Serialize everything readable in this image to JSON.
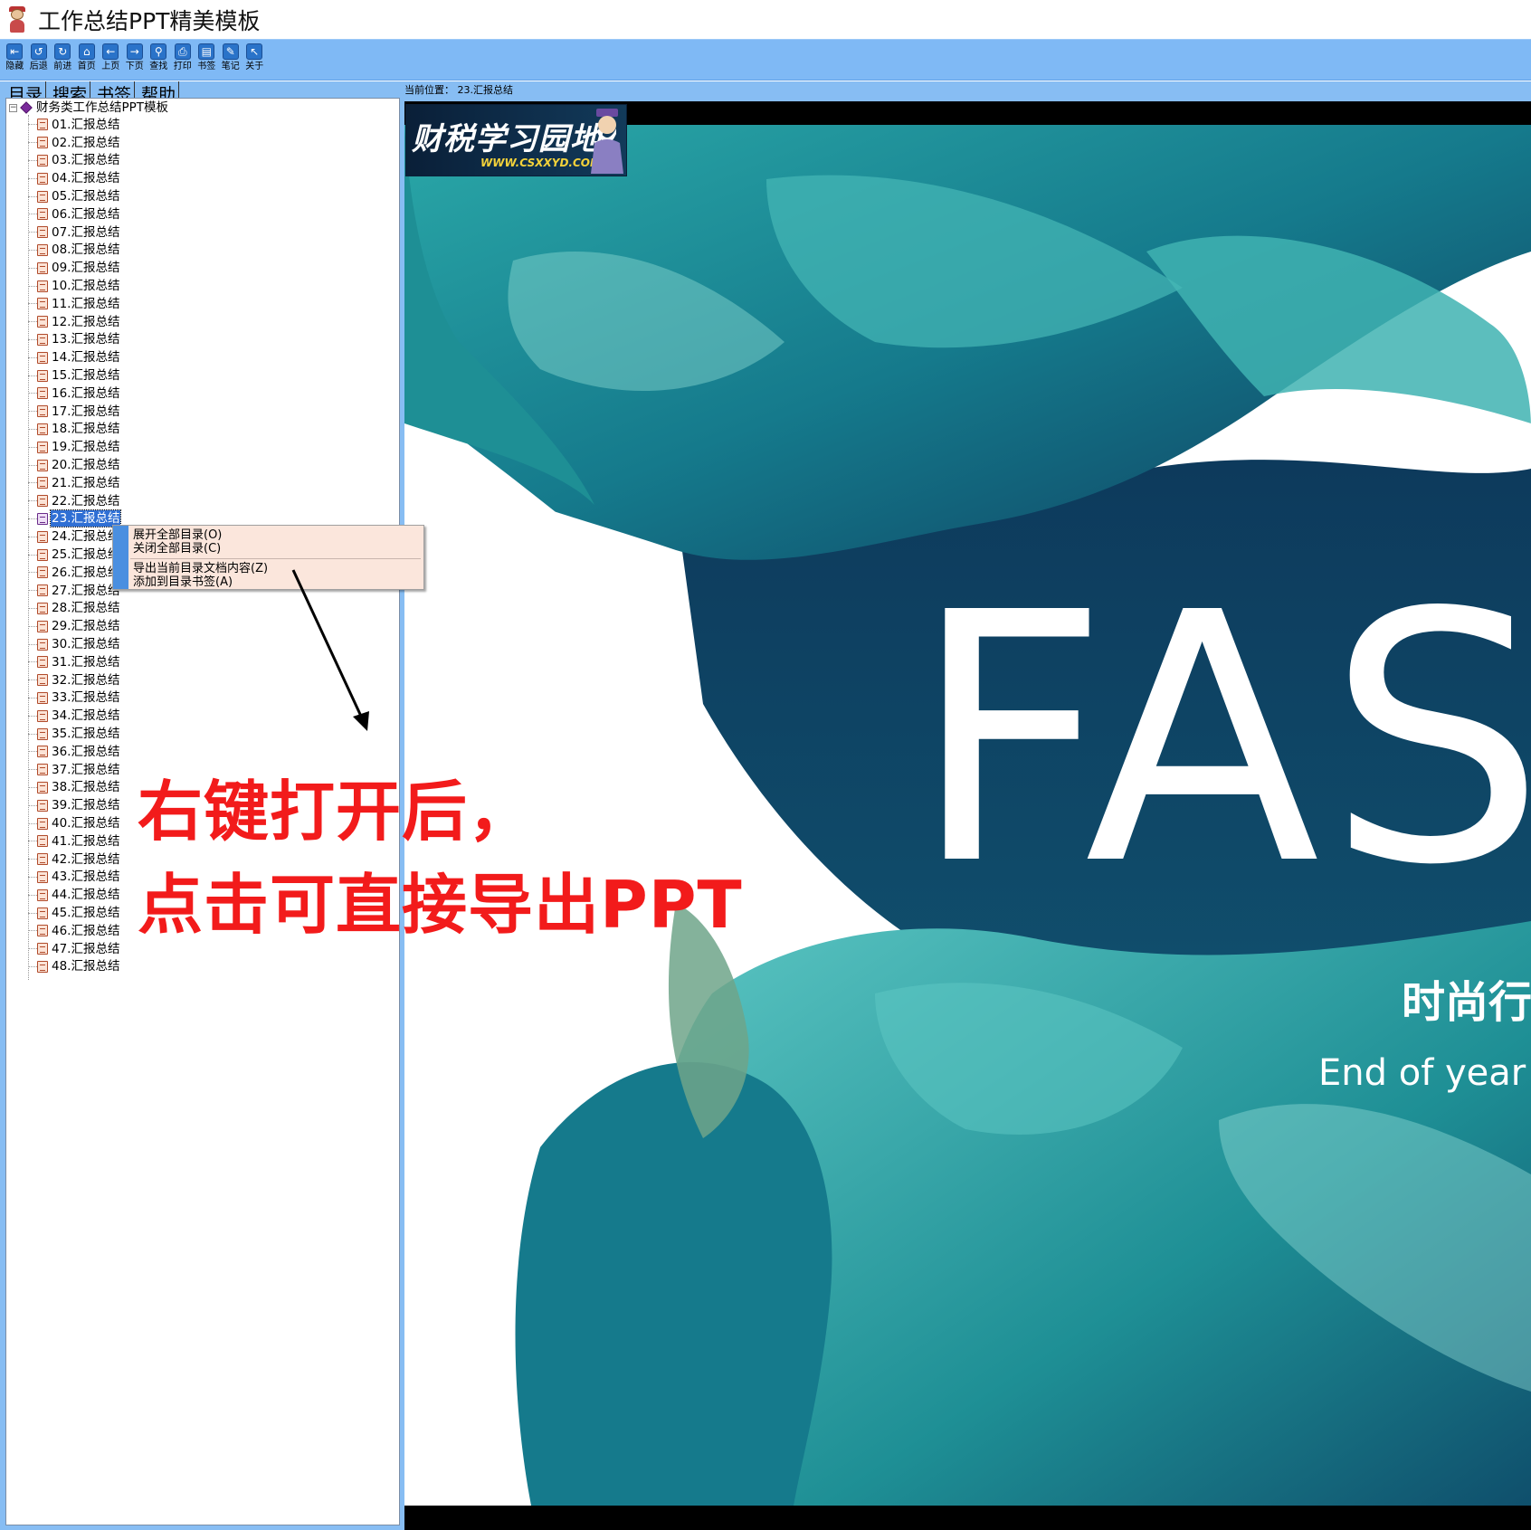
{
  "window": {
    "title": "工作总结PPT精美模板"
  },
  "toolbar": {
    "buttons": [
      {
        "label": "隐藏",
        "icon": "hide-icon",
        "glyph": "⇤"
      },
      {
        "label": "后退",
        "icon": "back-icon",
        "glyph": "↺"
      },
      {
        "label": "前进",
        "icon": "forward-icon",
        "glyph": "↻"
      },
      {
        "label": "首页",
        "icon": "home-icon",
        "glyph": "⌂"
      },
      {
        "label": "上页",
        "icon": "prev-page-icon",
        "glyph": "←"
      },
      {
        "label": "下页",
        "icon": "next-page-icon",
        "glyph": "→"
      },
      {
        "label": "查找",
        "icon": "search-icon",
        "glyph": "⚲"
      },
      {
        "label": "打印",
        "icon": "print-icon",
        "glyph": "⎙"
      },
      {
        "label": "书签",
        "icon": "bookmark-icon",
        "glyph": "▤"
      },
      {
        "label": "笔记",
        "icon": "note-icon",
        "glyph": "✎"
      },
      {
        "label": "关于",
        "icon": "about-icon",
        "glyph": "↖"
      }
    ]
  },
  "sidebar": {
    "tabs": [
      "目录",
      "搜索",
      "书签",
      "帮助"
    ],
    "root_label": "财务类工作总结PPT模板",
    "items": [
      "01.汇报总结",
      "02.汇报总结",
      "03.汇报总结",
      "04.汇报总结",
      "05.汇报总结",
      "06.汇报总结",
      "07.汇报总结",
      "08.汇报总结",
      "09.汇报总结",
      "10.汇报总结",
      "11.汇报总结",
      "12.汇报总结",
      "13.汇报总结",
      "14.汇报总结",
      "15.汇报总结",
      "16.汇报总结",
      "17.汇报总结",
      "18.汇报总结",
      "19.汇报总结",
      "20.汇报总结",
      "21.汇报总结",
      "22.汇报总结",
      "23.汇报总结",
      "24.汇报总结",
      "25.汇报总结",
      "26.汇报总结",
      "27.汇报总结",
      "28.汇报总结",
      "29.汇报总结",
      "30.汇报总结",
      "31.汇报总结",
      "32.汇报总结",
      "33.汇报总结",
      "34.汇报总结",
      "35.汇报总结",
      "36.汇报总结",
      "37.汇报总结",
      "38.汇报总结",
      "39.汇报总结",
      "40.汇报总结",
      "41.汇报总结",
      "42.汇报总结",
      "43.汇报总结",
      "44.汇报总结",
      "45.汇报总结",
      "46.汇报总结",
      "47.汇报总结",
      "48.汇报总结"
    ],
    "selected_label": "23.汇报总结"
  },
  "context_menu": {
    "expand_all": "展开全部目录(O)",
    "collapse_all": "关闭全部目录(C)",
    "export_doc": "导出当前目录文档内容(Z)",
    "add_bookmark": "添加到目录书签(A)"
  },
  "annotation": {
    "line1": "右键打开后，",
    "line2": "点击可直接导出PPT",
    "color": "#f21b1b"
  },
  "content": {
    "location_label": "当前位置：",
    "location_value": "23.汇报总结",
    "watermark_main": "财税学习园地",
    "watermark_url": "WWW.CSXXYD.COM",
    "slide_title": "FASI",
    "slide_subtitle_cn": "时尚行",
    "slide_subtitle_en": "End of year w"
  },
  "colors": {
    "toolbar_bg": "#7fb9f5",
    "panel_bg": "#87bdf3",
    "selection": "#2f6fd4",
    "menu_bg": "#fbe6dc",
    "ink_dark": "#0d3a5c",
    "ink_teal": "#1e8f95",
    "ink_light": "#5cc6c3"
  }
}
